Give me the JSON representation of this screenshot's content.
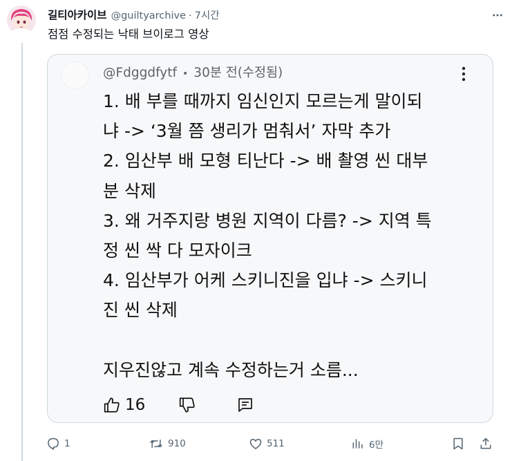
{
  "tweet": {
    "display_name": "길티아카이브",
    "handle": "@guiltyarchive",
    "separator": "·",
    "time": "7시간",
    "text": "점점 수정되는 낙태 브이로그 영상"
  },
  "quoted_comment": {
    "handle": "@Fdggdfytf",
    "separator": "•",
    "time": "30분 전(수정됨)",
    "lines": [
      "1. 배 부를 때까지 임신인지 모르는게 말이되",
      "냐 -> ‘3월 쯤 생리가 멈춰서’ 자막 추가",
      "2. 임산부 배 모형 티난다 -> 배 촬영 씬 대부",
      "분 삭제",
      "3. 왜 거주지랑 병원 지역이 다름? -> 지역 특",
      "정 씬 싹 다 모자이크",
      "4. 임산부가 어케 스키니진을 입냐 -> 스키니",
      "진 씬 삭제",
      "",
      "지우진않고 계속 수정하는거 소름..."
    ],
    "like_count": "16"
  },
  "actions": {
    "replies": "1",
    "reposts": "910",
    "likes": "511",
    "views": "6만"
  },
  "colors": {
    "muted": "#536471",
    "border": "#cfd9de",
    "card_bg": "#f7f8f9"
  }
}
